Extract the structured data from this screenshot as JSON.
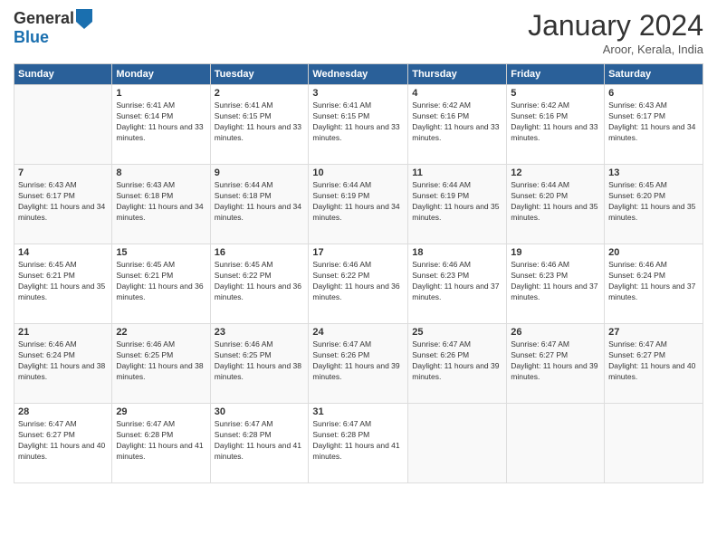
{
  "logo": {
    "general": "General",
    "blue": "Blue"
  },
  "header": {
    "title": "January 2024",
    "subtitle": "Aroor, Kerala, India"
  },
  "weekdays": [
    "Sunday",
    "Monday",
    "Tuesday",
    "Wednesday",
    "Thursday",
    "Friday",
    "Saturday"
  ],
  "weeks": [
    [
      {
        "day": "",
        "sunrise": "",
        "sunset": "",
        "daylight": ""
      },
      {
        "day": "1",
        "sunrise": "Sunrise: 6:41 AM",
        "sunset": "Sunset: 6:14 PM",
        "daylight": "Daylight: 11 hours and 33 minutes."
      },
      {
        "day": "2",
        "sunrise": "Sunrise: 6:41 AM",
        "sunset": "Sunset: 6:15 PM",
        "daylight": "Daylight: 11 hours and 33 minutes."
      },
      {
        "day": "3",
        "sunrise": "Sunrise: 6:41 AM",
        "sunset": "Sunset: 6:15 PM",
        "daylight": "Daylight: 11 hours and 33 minutes."
      },
      {
        "day": "4",
        "sunrise": "Sunrise: 6:42 AM",
        "sunset": "Sunset: 6:16 PM",
        "daylight": "Daylight: 11 hours and 33 minutes."
      },
      {
        "day": "5",
        "sunrise": "Sunrise: 6:42 AM",
        "sunset": "Sunset: 6:16 PM",
        "daylight": "Daylight: 11 hours and 33 minutes."
      },
      {
        "day": "6",
        "sunrise": "Sunrise: 6:43 AM",
        "sunset": "Sunset: 6:17 PM",
        "daylight": "Daylight: 11 hours and 34 minutes."
      }
    ],
    [
      {
        "day": "7",
        "sunrise": "Sunrise: 6:43 AM",
        "sunset": "Sunset: 6:17 PM",
        "daylight": "Daylight: 11 hours and 34 minutes."
      },
      {
        "day": "8",
        "sunrise": "Sunrise: 6:43 AM",
        "sunset": "Sunset: 6:18 PM",
        "daylight": "Daylight: 11 hours and 34 minutes."
      },
      {
        "day": "9",
        "sunrise": "Sunrise: 6:44 AM",
        "sunset": "Sunset: 6:18 PM",
        "daylight": "Daylight: 11 hours and 34 minutes."
      },
      {
        "day": "10",
        "sunrise": "Sunrise: 6:44 AM",
        "sunset": "Sunset: 6:19 PM",
        "daylight": "Daylight: 11 hours and 34 minutes."
      },
      {
        "day": "11",
        "sunrise": "Sunrise: 6:44 AM",
        "sunset": "Sunset: 6:19 PM",
        "daylight": "Daylight: 11 hours and 35 minutes."
      },
      {
        "day": "12",
        "sunrise": "Sunrise: 6:44 AM",
        "sunset": "Sunset: 6:20 PM",
        "daylight": "Daylight: 11 hours and 35 minutes."
      },
      {
        "day": "13",
        "sunrise": "Sunrise: 6:45 AM",
        "sunset": "Sunset: 6:20 PM",
        "daylight": "Daylight: 11 hours and 35 minutes."
      }
    ],
    [
      {
        "day": "14",
        "sunrise": "Sunrise: 6:45 AM",
        "sunset": "Sunset: 6:21 PM",
        "daylight": "Daylight: 11 hours and 35 minutes."
      },
      {
        "day": "15",
        "sunrise": "Sunrise: 6:45 AM",
        "sunset": "Sunset: 6:21 PM",
        "daylight": "Daylight: 11 hours and 36 minutes."
      },
      {
        "day": "16",
        "sunrise": "Sunrise: 6:45 AM",
        "sunset": "Sunset: 6:22 PM",
        "daylight": "Daylight: 11 hours and 36 minutes."
      },
      {
        "day": "17",
        "sunrise": "Sunrise: 6:46 AM",
        "sunset": "Sunset: 6:22 PM",
        "daylight": "Daylight: 11 hours and 36 minutes."
      },
      {
        "day": "18",
        "sunrise": "Sunrise: 6:46 AM",
        "sunset": "Sunset: 6:23 PM",
        "daylight": "Daylight: 11 hours and 37 minutes."
      },
      {
        "day": "19",
        "sunrise": "Sunrise: 6:46 AM",
        "sunset": "Sunset: 6:23 PM",
        "daylight": "Daylight: 11 hours and 37 minutes."
      },
      {
        "day": "20",
        "sunrise": "Sunrise: 6:46 AM",
        "sunset": "Sunset: 6:24 PM",
        "daylight": "Daylight: 11 hours and 37 minutes."
      }
    ],
    [
      {
        "day": "21",
        "sunrise": "Sunrise: 6:46 AM",
        "sunset": "Sunset: 6:24 PM",
        "daylight": "Daylight: 11 hours and 38 minutes."
      },
      {
        "day": "22",
        "sunrise": "Sunrise: 6:46 AM",
        "sunset": "Sunset: 6:25 PM",
        "daylight": "Daylight: 11 hours and 38 minutes."
      },
      {
        "day": "23",
        "sunrise": "Sunrise: 6:46 AM",
        "sunset": "Sunset: 6:25 PM",
        "daylight": "Daylight: 11 hours and 38 minutes."
      },
      {
        "day": "24",
        "sunrise": "Sunrise: 6:47 AM",
        "sunset": "Sunset: 6:26 PM",
        "daylight": "Daylight: 11 hours and 39 minutes."
      },
      {
        "day": "25",
        "sunrise": "Sunrise: 6:47 AM",
        "sunset": "Sunset: 6:26 PM",
        "daylight": "Daylight: 11 hours and 39 minutes."
      },
      {
        "day": "26",
        "sunrise": "Sunrise: 6:47 AM",
        "sunset": "Sunset: 6:27 PM",
        "daylight": "Daylight: 11 hours and 39 minutes."
      },
      {
        "day": "27",
        "sunrise": "Sunrise: 6:47 AM",
        "sunset": "Sunset: 6:27 PM",
        "daylight": "Daylight: 11 hours and 40 minutes."
      }
    ],
    [
      {
        "day": "28",
        "sunrise": "Sunrise: 6:47 AM",
        "sunset": "Sunset: 6:27 PM",
        "daylight": "Daylight: 11 hours and 40 minutes."
      },
      {
        "day": "29",
        "sunrise": "Sunrise: 6:47 AM",
        "sunset": "Sunset: 6:28 PM",
        "daylight": "Daylight: 11 hours and 41 minutes."
      },
      {
        "day": "30",
        "sunrise": "Sunrise: 6:47 AM",
        "sunset": "Sunset: 6:28 PM",
        "daylight": "Daylight: 11 hours and 41 minutes."
      },
      {
        "day": "31",
        "sunrise": "Sunrise: 6:47 AM",
        "sunset": "Sunset: 6:28 PM",
        "daylight": "Daylight: 11 hours and 41 minutes."
      },
      {
        "day": "",
        "sunrise": "",
        "sunset": "",
        "daylight": ""
      },
      {
        "day": "",
        "sunrise": "",
        "sunset": "",
        "daylight": ""
      },
      {
        "day": "",
        "sunrise": "",
        "sunset": "",
        "daylight": ""
      }
    ]
  ]
}
